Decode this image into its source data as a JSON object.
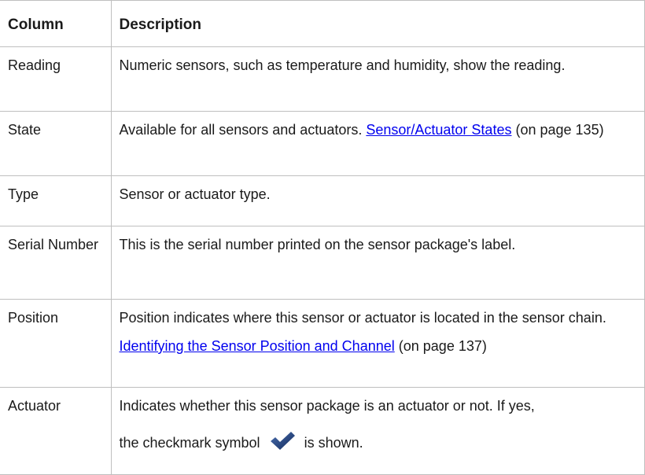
{
  "table": {
    "header": {
      "column": "Column",
      "description": "Description"
    },
    "rows": {
      "reading": {
        "name": "Reading",
        "text": "Numeric sensors, such as temperature and humidity, show the reading."
      },
      "state": {
        "name": "State",
        "text_before": "Available for all sensors and actuators.",
        "link": "Sensor/Actuator States",
        "text_after": "(on page 135)"
      },
      "type": {
        "name": "Type",
        "text": "Sensor or actuator type."
      },
      "serial": {
        "name": "Serial Number",
        "text": "This is the serial number printed on the sensor package's label."
      },
      "position": {
        "name": "Position",
        "text": "Position indicates where this sensor or actuator is located in the sensor chain.",
        "link": "Identifying the Sensor Position and Channel",
        "text_after": "(on page 137)"
      },
      "actuator": {
        "name": "Actuator",
        "text": "Indicates whether this sensor package is an actuator or not. If yes,",
        "check_before": "the checkmark symbol",
        "check_after": "is shown.",
        "icon": "checkmark-icon"
      }
    }
  },
  "colors": {
    "link": "#0000ee",
    "border": "#bfbfbf",
    "checkmark": "#1f3d73"
  }
}
